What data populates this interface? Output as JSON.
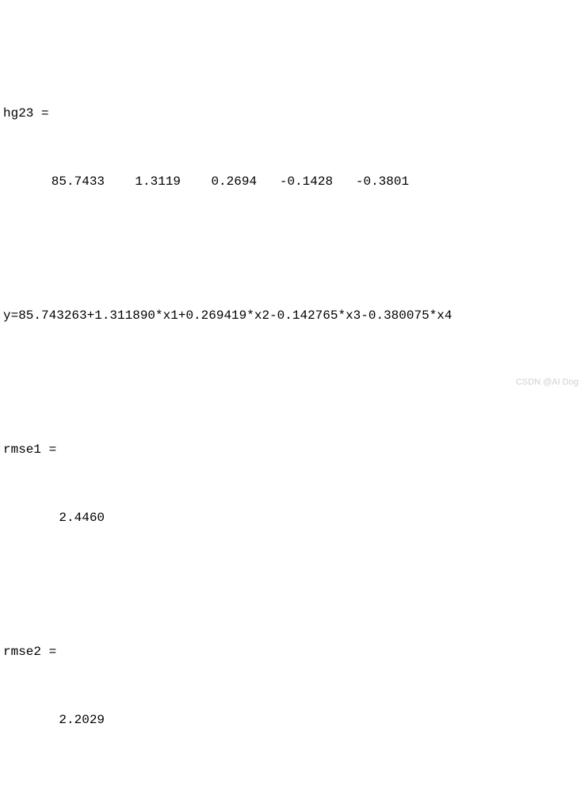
{
  "output": {
    "hg23": {
      "name": "hg23 =",
      "value": "   85.7433    1.3119    0.2694   -0.1428   -0.3801"
    },
    "equation": "y=85.743263+1.311890*x1+0.269419*x2-0.142765*x3-0.380075*x4",
    "rmse1": {
      "name": "rmse1 =",
      "value": "    2.4460"
    },
    "rmse2": {
      "name": "rmse2 =",
      "value": "    2.2029"
    }
  },
  "watermark": "CSDN @AI Dog"
}
